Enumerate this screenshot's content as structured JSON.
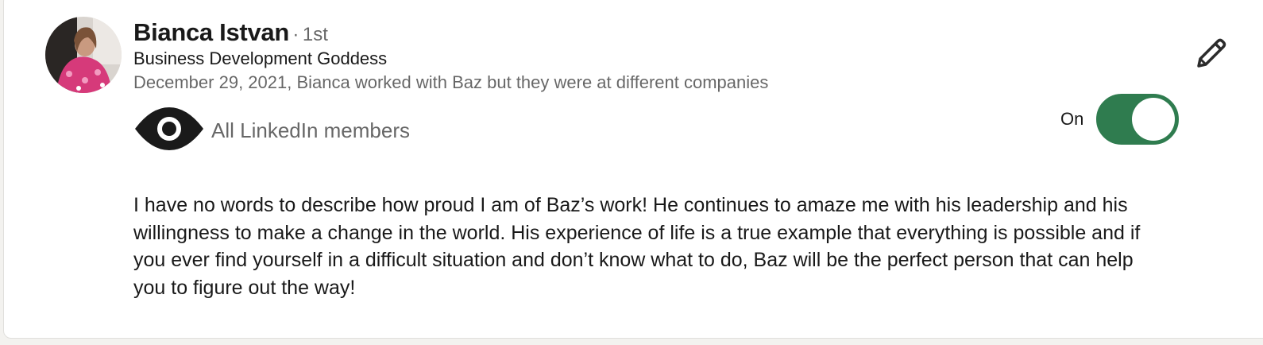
{
  "recommendation": {
    "name": "Bianca Istvan",
    "separator": "·",
    "degree": "1st",
    "headline": "Business Development Goddess",
    "relationship": "December 29, 2021, Bianca worked with Baz but they were at different companies",
    "visibility": {
      "icon": "eye-icon",
      "label": "All LinkedIn members"
    },
    "toggle": {
      "label": "On",
      "state": true,
      "color": "#2f7c4f"
    },
    "edit_icon": "pencil-icon",
    "text": "I have no words to describe how proud I am of Baz’s work! He continues to amaze me with his leadership and his willingness to make a change in the world. His experience of life is a true example that everything is possible and if you ever find yourself in a difficult situation and don’t know what to do, Baz will be the perfect person that can help you to figure out the way!"
  }
}
